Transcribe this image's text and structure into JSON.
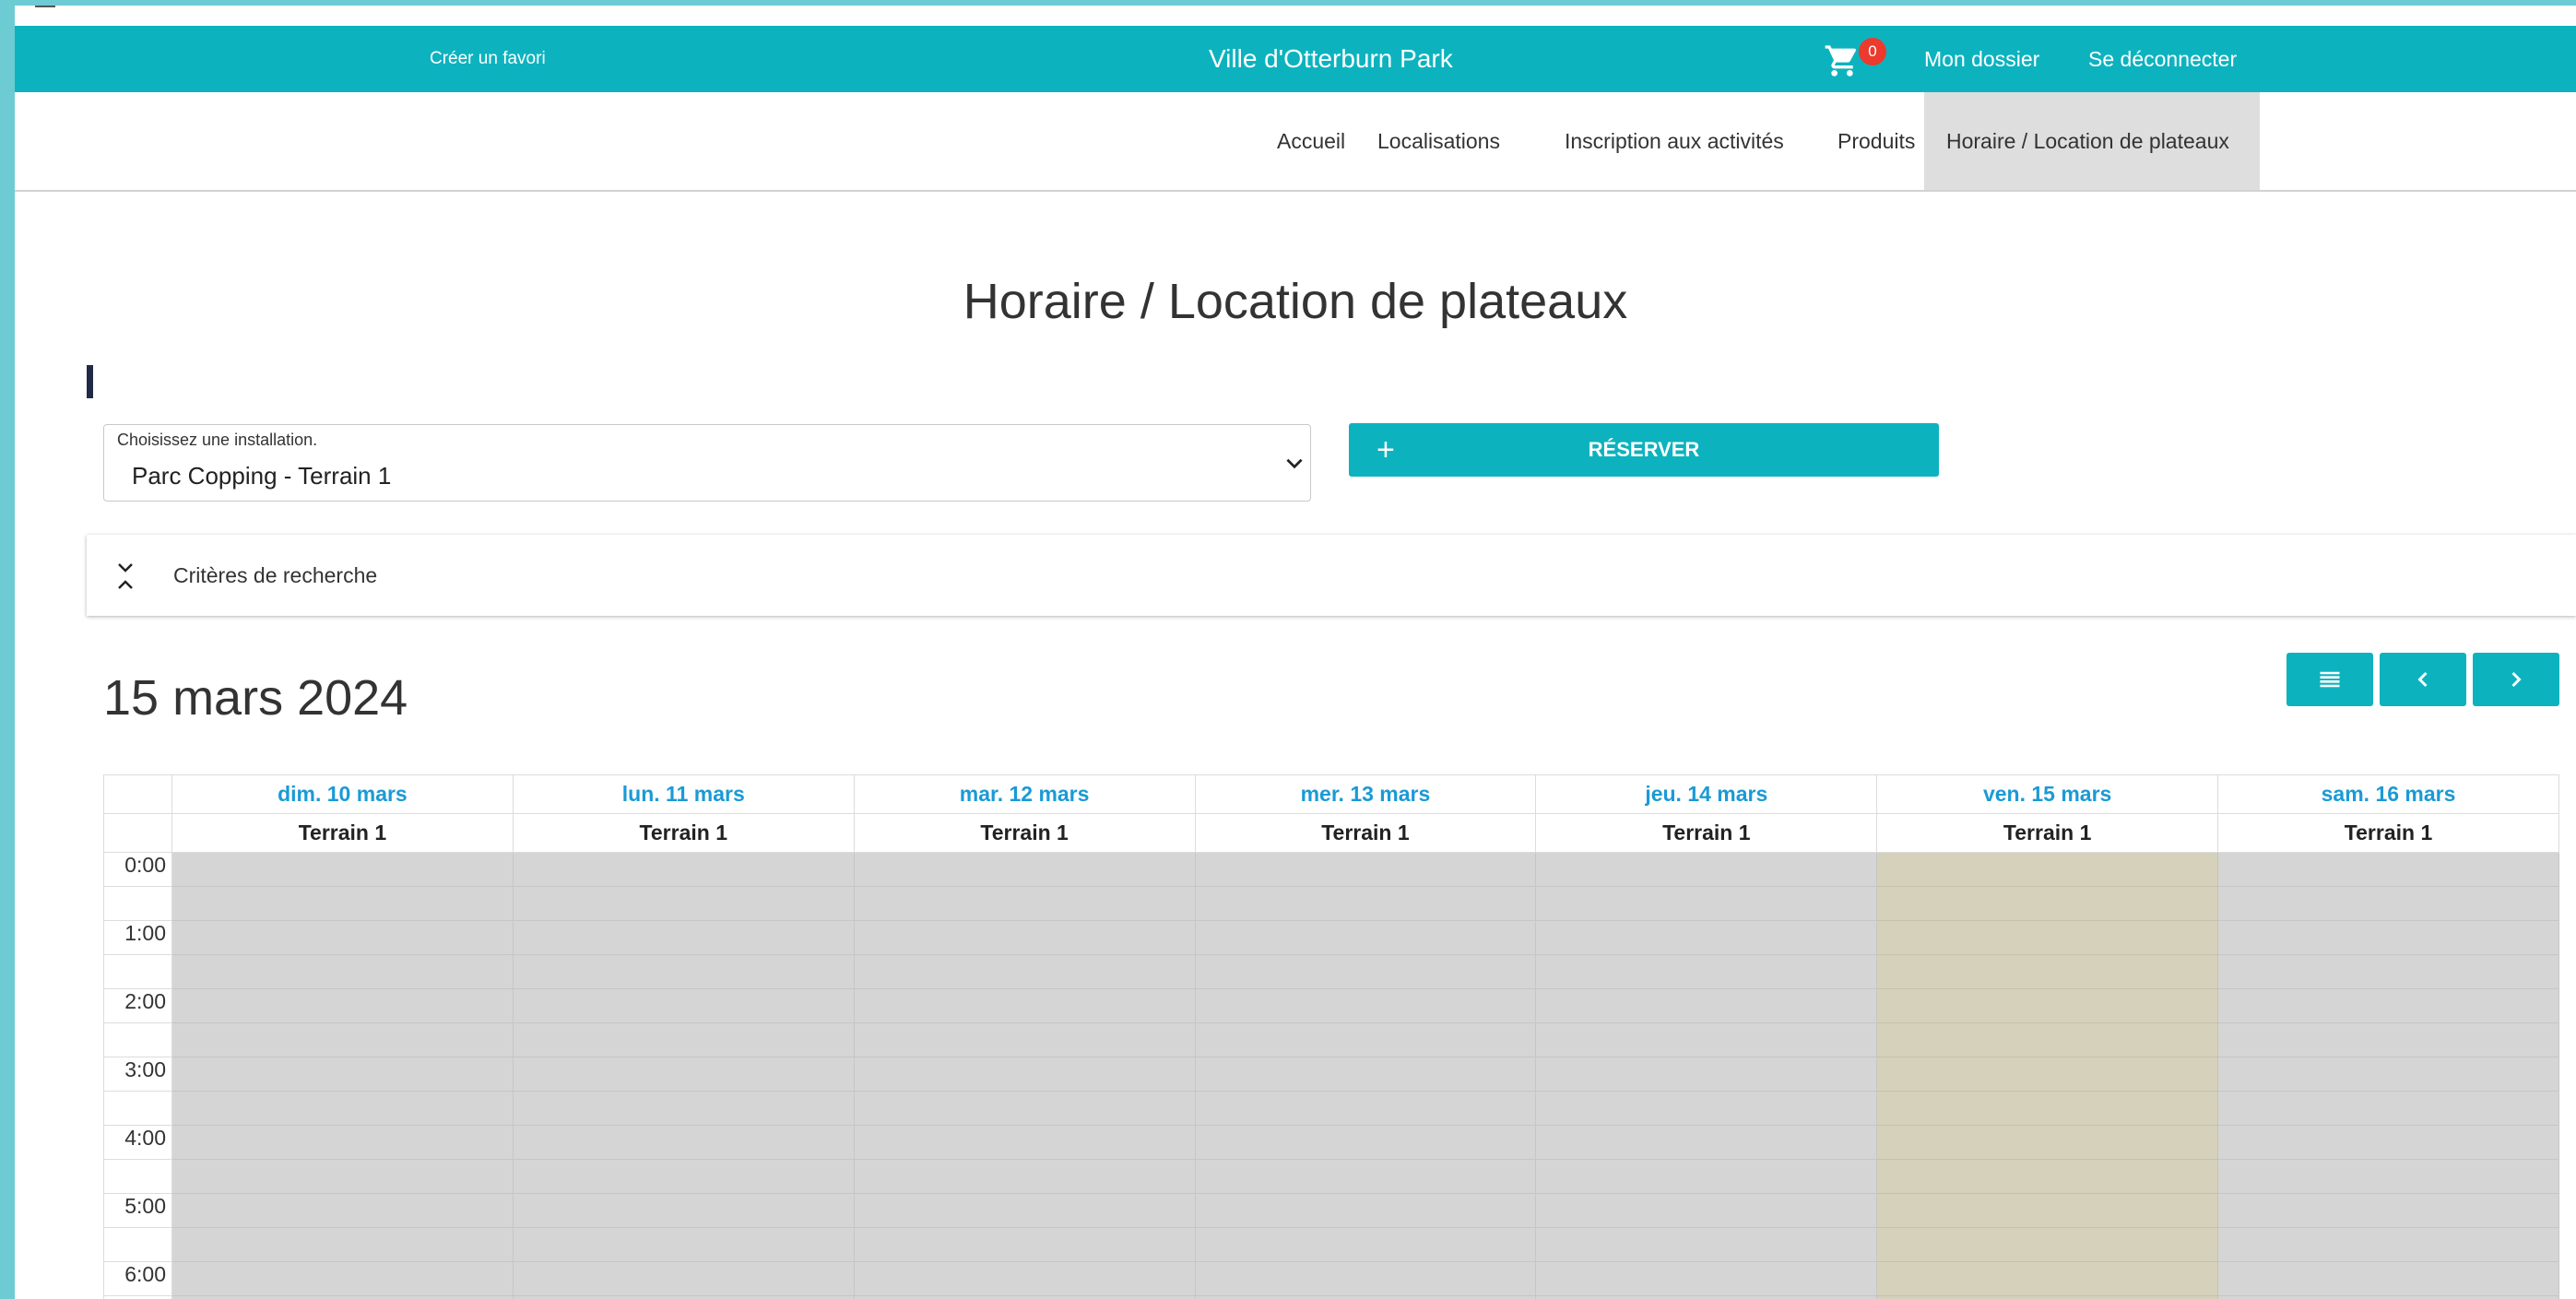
{
  "topbar": {
    "favorite": "Créer un favori",
    "city": "Ville d'Otterburn Park",
    "cart_count": "0",
    "account": "Mon dossier",
    "logout": "Se déconnecter"
  },
  "nav": {
    "items": [
      {
        "label": "Accueil"
      },
      {
        "label": "Localisations"
      },
      {
        "label": "Inscription aux activités"
      },
      {
        "label": "Produits"
      },
      {
        "label": "Horaire / Location de plateaux",
        "active": true
      }
    ]
  },
  "page": {
    "title": "Horaire / Location de plateaux"
  },
  "installation": {
    "label": "Choisissez une installation.",
    "value": "Parc Copping - Terrain 1"
  },
  "reserve": {
    "label": "RÉSERVER",
    "icon": "plus-icon"
  },
  "criteria": {
    "label": "Critères de recherche",
    "icon": "collapse-expand-icon"
  },
  "calendar": {
    "current_date": "15 mars 2024",
    "days": [
      {
        "label": "dim. 10 mars",
        "resource": "Terrain 1"
      },
      {
        "label": "lun. 11 mars",
        "resource": "Terrain 1"
      },
      {
        "label": "mar. 12 mars",
        "resource": "Terrain 1"
      },
      {
        "label": "mer. 13 mars",
        "resource": "Terrain 1"
      },
      {
        "label": "jeu. 14 mars",
        "resource": "Terrain 1"
      },
      {
        "label": "ven. 15 mars",
        "resource": "Terrain 1",
        "today": true
      },
      {
        "label": "sam. 16 mars",
        "resource": "Terrain 1"
      }
    ],
    "times": [
      "0:00",
      "1:00",
      "2:00",
      "3:00",
      "4:00",
      "5:00",
      "6:00"
    ]
  },
  "colors": {
    "accent": "#0cb3bf",
    "day_header": "#1a9ad6",
    "unavailable": "#d5d5d5",
    "today": "#d6d1bb",
    "badge": "#ec3a2f"
  }
}
